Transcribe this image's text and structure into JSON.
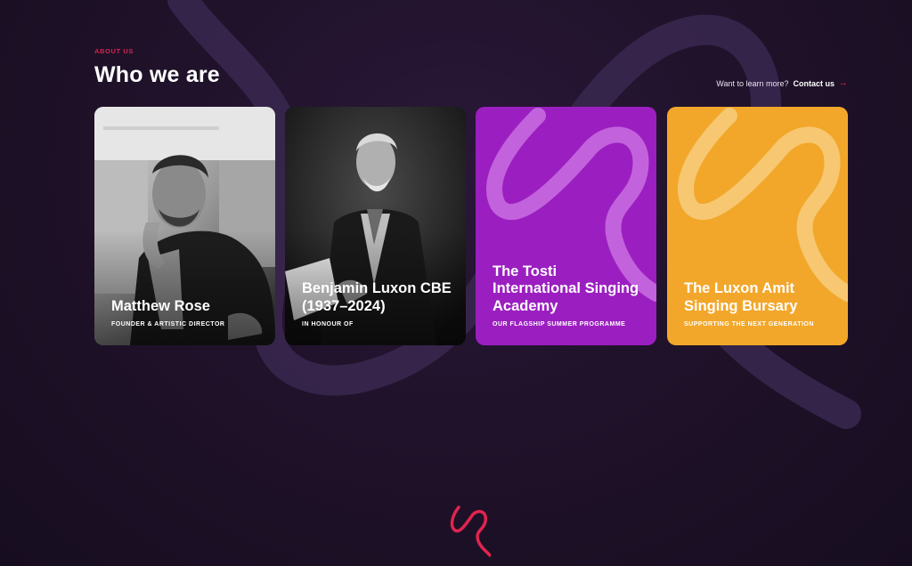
{
  "section": {
    "eyebrow": "ABOUT US",
    "title": "Who we are",
    "learn_more_text": "Want to learn more?",
    "contact_label": "Contact us",
    "arrow_icon": "arrow-right-icon"
  },
  "cards": [
    {
      "name": "Matthew Rose",
      "subtitle": "FOUNDER & ARTISTIC DIRECTOR",
      "kind": "photo"
    },
    {
      "name": "Benjamin Luxon CBE (1937–2024)",
      "subtitle": "IN HONOUR OF",
      "kind": "photo"
    },
    {
      "name": "The Tosti International Singing Academy",
      "subtitle": "OUR FLAGSHIP SUMMER PROGRAMME",
      "kind": "brand",
      "color": "#9b1fc0"
    },
    {
      "name": "The Luxon Amit Singing Bursary",
      "subtitle": "SUPPORTING THE NEXT GENERATION",
      "kind": "brand",
      "color": "#f2a72a"
    }
  ],
  "colors": {
    "background": "#1e1128",
    "accent": "#d1254f",
    "purple_card": "#9b1fc0",
    "orange_card": "#f2a72a"
  },
  "footer": {
    "logo_icon": "squiggle-logo-icon"
  }
}
